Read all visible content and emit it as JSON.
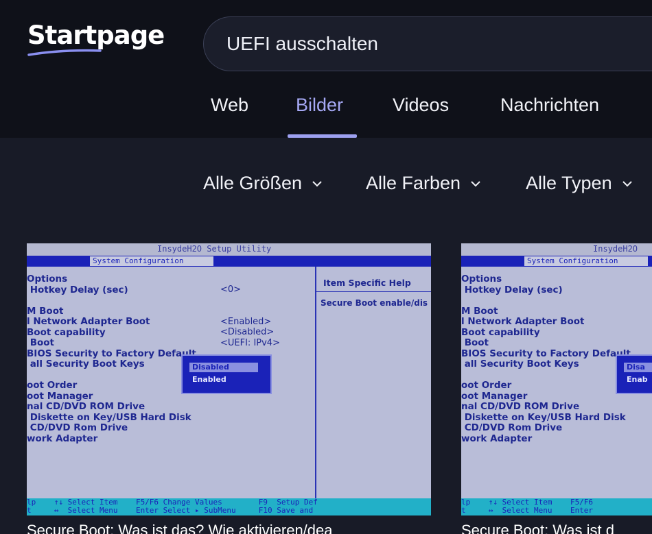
{
  "header": {
    "logo": "Startpage",
    "search": {
      "value": "UEFI ausschalten"
    }
  },
  "tabs": [
    {
      "label": "Web",
      "active": false
    },
    {
      "label": "Bilder",
      "active": true
    },
    {
      "label": "Videos",
      "active": false
    },
    {
      "label": "Nachrichten",
      "active": false
    }
  ],
  "filters": [
    {
      "label": "Alle Größen",
      "icon": "chevron-down-icon"
    },
    {
      "label": "Alle Farben",
      "icon": "chevron-down-icon"
    },
    {
      "label": "Alle Typen",
      "icon": "chevron-down-icon"
    }
  ],
  "results": [
    {
      "caption": "Secure Boot: Was ist das? Wie aktivieren/dea",
      "bios": {
        "title": "InsydeH2O Setup Utility",
        "tab": "System Configuration",
        "help_head": "Item Specific Help",
        "help_text": "Secure Boot enable/dis",
        "popup_selected": "Disabled",
        "popup_option": "Enabled"
      }
    },
    {
      "caption": "Secure Boot: Was ist d",
      "bios": {
        "title": "InsydeH2O",
        "tab": "System Configuration"
      }
    }
  ],
  "colors": {
    "accent": "#a6a9f5",
    "header_bg": "#0f1119",
    "page_bg": "#181b27"
  }
}
